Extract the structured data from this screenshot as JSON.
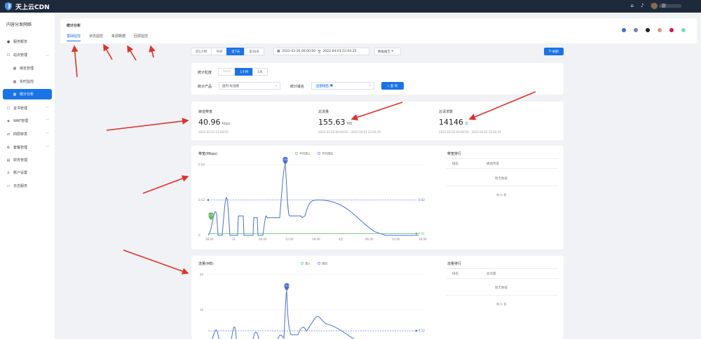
{
  "brand": {
    "name": "天上云CDN"
  },
  "topbar": {
    "icons": [
      "home-icon",
      "bell-icon",
      "fullscreen-icon",
      "grid-icon"
    ]
  },
  "sidebar": {
    "title": "内容分发网络",
    "items": [
      {
        "label": "服务概览",
        "icon": "dot-icon"
      },
      {
        "label": "站点管理",
        "icon": "site-icon"
      },
      {
        "label": "域名管理",
        "icon": "grid-icon"
      },
      {
        "label": "实时监控",
        "icon": "grid-icon"
      },
      {
        "label": "统计分析",
        "icon": "grid-icon"
      },
      {
        "label": "证书管理",
        "icon": "cert-icon"
      },
      {
        "label": "WAF管理",
        "icon": "shield-icon"
      },
      {
        "label": "四层转发",
        "icon": "forward-icon"
      },
      {
        "label": "套餐管理",
        "icon": "package-icon"
      },
      {
        "label": "财务管理",
        "icon": "finance-icon"
      },
      {
        "label": "账户设置",
        "icon": "user-icon"
      },
      {
        "label": "日志服务",
        "icon": "log-icon"
      }
    ]
  },
  "page": {
    "heading": "统计分析",
    "tabs": [
      "基础监控",
      "状态监控",
      "来源数据",
      "回源监控"
    ]
  },
  "theme_colors": [
    "#3a6fd8",
    "#7a7fb0",
    "#222222",
    "#c9a27a",
    "#d8164c",
    "#7fd8c6"
  ],
  "filter": {
    "ranges": [
      "近1小时",
      "今日",
      "近7天",
      "近30天"
    ],
    "selected_range": "近7天",
    "date_from": "2022-03-26 00:00:00",
    "date_sep": "至",
    "date_to": "2022-04-01 22:04:35",
    "report_btn": "数据报告",
    "refresh_btn": "刷新",
    "granularity_label": "统计粒度",
    "granularity_options": [
      "5min",
      "1小时",
      "1天"
    ],
    "granularity_selected": "1小时",
    "product_label": "统计产品",
    "product_value": "国内-标准版",
    "domain_label": "统计域名",
    "domain_tag": "全部域名",
    "query_btn": "查 询"
  },
  "stats": [
    {
      "label": "峰值带宽",
      "value": "40.96",
      "unit": "Kbps",
      "range": "2022-03-31 13:00:00"
    },
    {
      "label": "总流量",
      "value": "155.63",
      "unit": "MB",
      "range": "2022-03-26 00:00:00 - 2022-04-01 22:04:35"
    },
    {
      "label": "总请求数",
      "value": "14146",
      "unit": "次",
      "range": "2022-03-26 00:00:00 - 2022-04-01 22:04:35"
    }
  ],
  "bandwidth_chart": {
    "title": "带宽(Mbps)",
    "legend": [
      "平均流入",
      "平均流出"
    ],
    "y_ticks": [
      "0.04",
      "0.02",
      "0"
    ],
    "x_ticks": [
      "18:00",
      "31",
      "06:00",
      "12:00",
      "18:00",
      "4月",
      "06:00",
      "12:00",
      "18:00"
    ],
    "peak_label": "0.04",
    "low_label": "0.01",
    "markline_right_top": "0.02",
    "markline_right_bottom": "0.01",
    "rank_title": "带宽排行",
    "rank_cols": [
      "域名",
      "峰值带宽"
    ],
    "empty": "暂无数据",
    "total": "共 0 条"
  },
  "traffic_chart": {
    "title": "流量(MB)",
    "legend": [
      "流入",
      "流出"
    ],
    "y_ticks": [
      "20",
      "10"
    ],
    "peak_label": "15.4",
    "markline_right": "4.12",
    "rank_title": "流量排行",
    "rank_cols": [
      "域名",
      "总流量"
    ],
    "empty": "暂无数据",
    "total": "共 0 条"
  },
  "chart_data": [
    {
      "type": "line",
      "title": "带宽(Mbps)",
      "x": [
        "18:00",
        "31",
        "06:00",
        "12:00",
        "18:00",
        "4月",
        "06:00",
        "12:00",
        "18:00"
      ],
      "series": [
        {
          "name": "平均流出",
          "values": [
            0.0,
            0.012,
            0.025,
            0.01,
            0.042,
            0.015,
            0.03,
            0.02,
            0.0
          ]
        },
        {
          "name": "平均流入",
          "values": [
            0.01,
            0.01,
            0.01,
            0.01,
            0.01,
            0.01,
            0.01,
            0.01,
            0.01
          ]
        }
      ],
      "ylim": [
        0,
        0.04
      ]
    },
    {
      "type": "line",
      "title": "流量(MB)",
      "series": [
        {
          "name": "流出",
          "values": [
            2,
            7,
            5,
            4,
            15.4,
            6,
            9,
            4,
            0
          ]
        },
        {
          "name": "流入",
          "values": [
            0,
            0,
            0,
            0,
            0,
            0,
            0,
            0,
            0
          ]
        }
      ],
      "ylim": [
        0,
        20
      ]
    }
  ]
}
